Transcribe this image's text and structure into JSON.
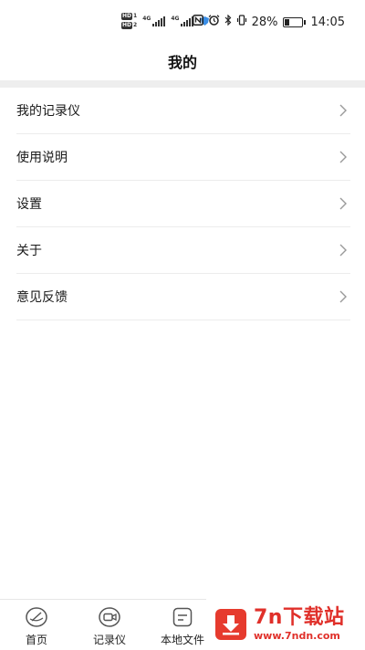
{
  "status_bar": {
    "sim1_badge": "HD",
    "sim1_num": "1",
    "sim2_badge": "HD",
    "sim2_num": "2",
    "net1": "4G",
    "net2": "4G",
    "battery_percent": "28%",
    "battery_level": 0.28,
    "time": "14:05"
  },
  "header": {
    "title": "我的"
  },
  "menu": {
    "items": [
      {
        "label": "我的记录仪"
      },
      {
        "label": "使用说明"
      },
      {
        "label": "设置"
      },
      {
        "label": "关于"
      },
      {
        "label": "意见反馈"
      }
    ]
  },
  "bottom_nav": {
    "items": [
      {
        "label": "首页",
        "icon": "compass-icon"
      },
      {
        "label": "记录仪",
        "icon": "video-camera-icon"
      },
      {
        "label": "本地文件",
        "icon": "file-icon"
      }
    ]
  },
  "watermark": {
    "main": "7n下载站",
    "url": "www.7ndn.com",
    "color": "#e0302a"
  }
}
